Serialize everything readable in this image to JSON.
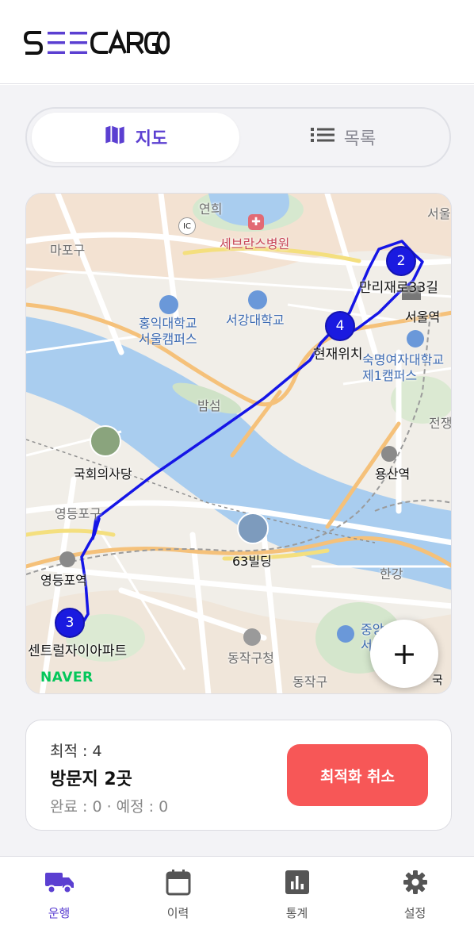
{
  "app": {
    "logo_text": "SEECARGO",
    "brand_color": "#5b3fd1"
  },
  "view_toggle": {
    "map_label": "지도",
    "list_label": "목록",
    "selected": "map"
  },
  "map": {
    "provider_logo": "NAVER",
    "labels": {
      "ic": "IC",
      "yeonhui": "연희",
      "seoul_edge": "서울",
      "severance": "세브란스병원",
      "mapo": "마포구",
      "hongik1": "홍익대학교",
      "hongik2": "서울캠퍼스",
      "sogang": "서강대학교",
      "seoul_station": "서울역",
      "sookmyung1": "숙명여자대학교",
      "sookmyung2": "제1캠퍼스",
      "bamseom": "밤섬",
      "national_assembly": "국회의사당",
      "yeongdeungpo_gu": "영등포구",
      "yeongdeungpo_station": "영등포역",
      "yongsan_station": "용산역",
      "jeonjaeng": "전쟁",
      "building63": "63빌딩",
      "hangang": "한강",
      "dongjak_office": "동작구청",
      "dongjak": "동작구",
      "chungang1": "중앙",
      "chungang2": "서",
      "gukrip": "국립",
      "right_edge": "국"
    },
    "markers": [
      {
        "num": "2",
        "label": "만리재로33길"
      },
      {
        "num": "4",
        "label": "현재위치"
      },
      {
        "num": "3",
        "label": "센트럴자이아파트"
      }
    ],
    "zoom_in_symbol": "+"
  },
  "summary": {
    "optimal": "최적 : 4",
    "visits": "방문지 2곳",
    "status": "완료 : 0 · 예정 : 0",
    "cancel_button": "최적화 취소",
    "cancel_color": "#f75757"
  },
  "tabs": [
    {
      "label": "운행",
      "icon": "truck-icon",
      "active": true
    },
    {
      "label": "이력",
      "icon": "calendar-icon",
      "active": false
    },
    {
      "label": "통계",
      "icon": "bar-chart-icon",
      "active": false
    },
    {
      "label": "설정",
      "icon": "gear-icon",
      "active": false
    }
  ]
}
